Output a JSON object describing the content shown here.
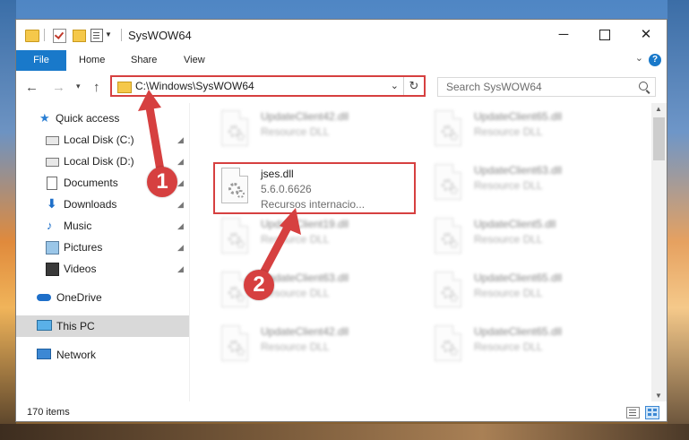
{
  "window": {
    "title": "SysWOW64",
    "minimize_label": "─",
    "maximize_label": "",
    "close_label": "✕"
  },
  "ribbon": {
    "tabs": [
      "File",
      "Home",
      "Share",
      "View"
    ],
    "collapse_label": "⌄",
    "help_label": "?"
  },
  "navbar": {
    "back_label": "←",
    "forward_label": "→",
    "recent_label": "▾",
    "up_label": "↑",
    "address": "C:\\Windows\\SysWOW64",
    "address_dropdown_label": "⌄",
    "refresh_label": "↻",
    "search_placeholder": "Search SysWOW64"
  },
  "sidebar": {
    "items": [
      {
        "label": "Quick access",
        "icon": "star-icon",
        "pinned": false
      },
      {
        "label": "Local Disk (C:)",
        "icon": "disk-icon",
        "pinned": true
      },
      {
        "label": "Local Disk (D:)",
        "icon": "disk-icon",
        "pinned": true
      },
      {
        "label": "Documents",
        "icon": "documents-icon",
        "pinned": true
      },
      {
        "label": "Downloads",
        "icon": "downloads-icon",
        "pinned": true
      },
      {
        "label": "Music",
        "icon": "music-icon",
        "pinned": true
      },
      {
        "label": "Pictures",
        "icon": "pictures-icon",
        "pinned": true
      },
      {
        "label": "Videos",
        "icon": "videos-icon",
        "pinned": true
      },
      {
        "label": "OneDrive",
        "icon": "onedrive-icon",
        "pinned": false
      },
      {
        "label": "This PC",
        "icon": "this-pc-icon",
        "pinned": false,
        "selected": true
      },
      {
        "label": "Network",
        "icon": "network-icon",
        "pinned": false
      }
    ],
    "pin_glyph": "📌"
  },
  "content": {
    "highlighted_file": {
      "name": "jses.dll",
      "version": "5.6.0.6626",
      "type": "Recursos internacio..."
    },
    "files": [
      {
        "name": "UpdateClient42.dll",
        "type": "Resource DLL"
      },
      {
        "name": "UpdateClient65.dll",
        "type": "Resource DLL"
      },
      {
        "name": "UpdateClient63.dll",
        "type": "Resource DLL"
      },
      {
        "name": "UpdateClient19.dll",
        "type": "Resource DLL"
      },
      {
        "name": "UpdateClient5.dll",
        "type": "Resource DLL"
      },
      {
        "name": "UpdateClient63.dll",
        "type": "Resource DLL"
      },
      {
        "name": "UpdateClient65.dll",
        "type": "Resource DLL"
      },
      {
        "name": "UpdateClient42.dll",
        "type": "Resource DLL"
      },
      {
        "name": "UpdateClient65.dll",
        "type": "Resource DLL"
      }
    ]
  },
  "statusbar": {
    "item_count": "170 items"
  },
  "annotations": {
    "step1": "1",
    "step2": "2",
    "color": "#d64040"
  },
  "colors": {
    "accent": "#1979ca",
    "highlight": "#d64040",
    "folder": "#f5c84a"
  }
}
